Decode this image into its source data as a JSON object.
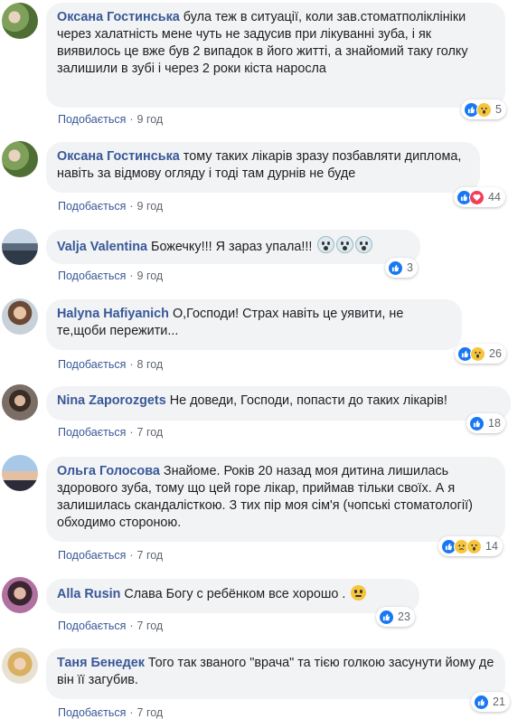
{
  "comments": [
    {
      "author": "Оксана Гостинська",
      "text": "була теж в ситуації, коли зав.стоматполіклініки через халатність мене чуть не задусив при лікуванні зуба, і як виявилось це вже був 2 випадок в його житті, а знайомий таку голку залишили в зубі і через 2 роки кіста наросла",
      "like_label": "Подобається",
      "time": "9 год",
      "reactions": [
        "like-icon",
        "wow-icon"
      ],
      "count": "5"
    },
    {
      "author": "Оксана Гостинська",
      "text": "тому таких лікарів зразу позбавляти диплома, навіть за відмову огляду і тоді там дурнів не буде",
      "like_label": "Подобається",
      "time": "9 год",
      "reactions": [
        "like-icon",
        "love-icon"
      ],
      "count": "44"
    },
    {
      "author": "Valja Valentina",
      "text": "Божечку!!! Я зараз упала!!!",
      "like_label": "Подобається",
      "time": "9 год",
      "reactions": [
        "like-icon"
      ],
      "count": "3"
    },
    {
      "author": "Halyna Hafiyanich",
      "text": "О,Господи! Страх навіть це уявити, не те,щоби пережити...",
      "like_label": "Подобається",
      "time": "8 год",
      "reactions": [
        "like-icon",
        "wow-icon"
      ],
      "count": "26"
    },
    {
      "author": "Nina Zaporozgets",
      "text": "Не доведи, Господи, попасти до таких лікарів!",
      "like_label": "Подобається",
      "time": "7 год",
      "reactions": [
        "like-icon"
      ],
      "count": "18"
    },
    {
      "author": "Ольга Голосова",
      "text": "Знайоме. Років 20 назад моя дитина лишилась здорового зуба, тому що цей горе лікар, приймав тільки своїх. А я залишилась скандалісткою. З тих пір моя сім'я (чопські стоматології) обходимо стороною.",
      "like_label": "Подобається",
      "time": "7 год",
      "reactions": [
        "like-icon",
        "sad-icon",
        "wow-icon"
      ],
      "count": "14"
    },
    {
      "author": "Alla Rusin",
      "text": "Слава Богу с ребёнком все хорошо .",
      "like_label": "Подобається",
      "time": "7 год",
      "reactions": [
        "like-icon"
      ],
      "count": "23"
    },
    {
      "author": "Таня Бенедек",
      "text": "Того так званого \"врача\" та тією голкою засунути йому де він її загубив.",
      "like_label": "Подобається",
      "time": "7 год",
      "reactions": [
        "like-icon"
      ],
      "count": "21"
    }
  ]
}
